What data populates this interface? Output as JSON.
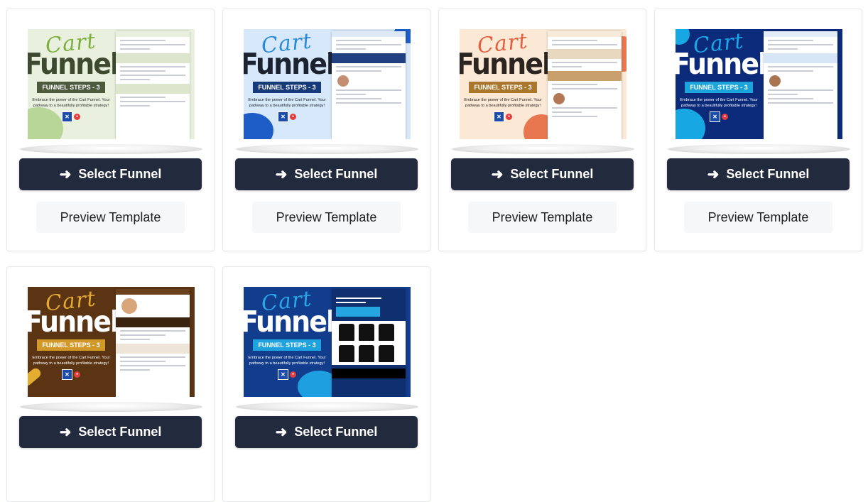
{
  "cards": [
    {
      "select_label": "Select Funnel",
      "preview_label": "Preview Template",
      "thumb": {
        "cart": "Cart",
        "funnel": "Funnel",
        "steps": "FUNNEL STEPS - 3",
        "embrace": "Embrace the power of the Cart Funnel. Your pathway to a beautifully profitable strategy!",
        "bg": "#e9f1de",
        "cart_color": "#7cae3f",
        "funnel_color": "#3d4a2f",
        "badge_color": "#4d5a3e",
        "blob_color": "#b9d699",
        "text_color": "#333333",
        "mock_header": "#e8f0dd",
        "mock_band": "#dbe6cc"
      }
    },
    {
      "select_label": "Select Funnel",
      "preview_label": "Preview Template",
      "thumb": {
        "cart": "Cart",
        "funnel": "Funnel",
        "steps": "FUNNEL STEPS - 3",
        "embrace": "Embrace the power of the Cart Funnel. Your pathway to a beautifully profitable strategy!",
        "bg": "#d7e8fb",
        "cart_color": "#2a8ad6",
        "funnel_color": "#1b2230",
        "badge_color": "#173a7a",
        "blob_color": "#1e5cc8",
        "text_color": "#1b2230",
        "mock_header": "#dde9f7",
        "mock_band": "#20407f"
      }
    },
    {
      "select_label": "Select Funnel",
      "preview_label": "Preview Template",
      "thumb": {
        "cart": "Cart",
        "funnel": "Funnel",
        "steps": "FUNNEL STEPS - 3",
        "embrace": "Embrace the power of the Cart Funnel. Your pathway to a beautifully profitable strategy!",
        "bg": "#fbe9d6",
        "cart_color": "#e2603f",
        "funnel_color": "#2b2420",
        "badge_color": "#a9782d",
        "blob_color": "#e8774f",
        "text_color": "#2b2420",
        "mock_header": "#f7ead9",
        "mock_band": "#c7a06b"
      }
    },
    {
      "select_label": "Select Funnel",
      "preview_label": "Preview Template",
      "thumb": {
        "cart": "Cart",
        "funnel": "Funnel",
        "steps": "FUNNEL STEPS - 3",
        "embrace": "Embrace the power of the Cart Funnel. Your pathway to a beautifully profitable strategy!",
        "bg": "#0c2a7a",
        "cart_color": "#1aa7e8",
        "funnel_color": "#ffffff",
        "badge_color": "#1ba4d9",
        "blob_color": "#17a8e4",
        "text_color": "#ffffff",
        "mock_header": "#e3edf9",
        "mock_band": "#d7e6f6"
      }
    },
    {
      "select_label": "Select Funnel",
      "thumb": {
        "cart": "Cart",
        "funnel": "Funnel",
        "steps": "FUNNEL STEPS - 3",
        "embrace": "Embrace the power of the Cart Funnel. Your pathway to a beautifully profitable strategy!",
        "bg": "#5a3413",
        "cart_color": "#e3a932",
        "funnel_color": "#ffffff",
        "badge_color": "#d19a28",
        "blob_color": "#e4ad2f",
        "text_color": "#ffffff",
        "mock_header": "#6a4220",
        "mock_band": "#3a2410"
      }
    },
    {
      "select_label": "Select Funnel",
      "thumb": {
        "cart": "Cart",
        "funnel": "Funnel",
        "steps": "FUNNEL STEPS - 3",
        "embrace": "Embrace the power of the Cart Funnel. Your pathway to a beautifully profitable strategy!",
        "bg": "#123c8c",
        "cart_color": "#28a6e6",
        "funnel_color": "#ffffff",
        "badge_color": "#1ea3de",
        "blob_color": "#1d9fe0",
        "text_color": "#ffffff",
        "mock_header": "#0f2f6e",
        "mock_band": "#24a7e0"
      }
    }
  ],
  "icons": {
    "arrow": "arrow-right-icon"
  }
}
